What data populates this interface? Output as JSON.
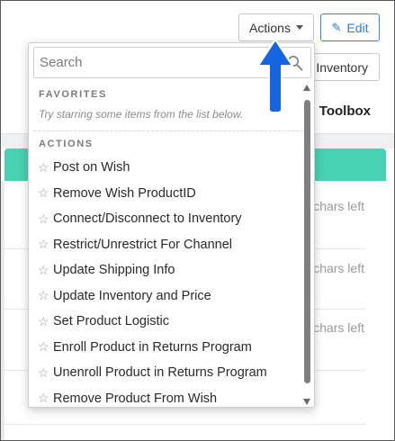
{
  "header": {
    "actions_label": "Actions",
    "edit_label": "Edit",
    "inventory_label": "Inventory",
    "toolbox_label": "Toolbox"
  },
  "background": {
    "chars_left_label": "chars left"
  },
  "dropdown": {
    "search_placeholder": "Search",
    "favorites_title": "FAVORITES",
    "favorites_hint": "Try starring some items from the list below.",
    "actions_title": "ACTIONS",
    "items": [
      {
        "label": "Post on Wish"
      },
      {
        "label": "Remove Wish ProductID"
      },
      {
        "label": "Connect/Disconnect to Inventory"
      },
      {
        "label": "Restrict/Unrestrict For Channel"
      },
      {
        "label": "Update Shipping Info"
      },
      {
        "label": "Update Inventory and Price"
      },
      {
        "label": "Set Product Logistic"
      },
      {
        "label": "Enroll Product in Returns Program"
      },
      {
        "label": "Unenroll Product in Returns Program"
      },
      {
        "label": "Remove Product From Wish"
      }
    ]
  },
  "icons": {
    "star": "star-outline-icon",
    "search": "search-icon",
    "edit": "pencil-icon",
    "caret": "caret-down-icon"
  },
  "colors": {
    "accent_blue": "#2c7be5",
    "teal": "#48d1b2",
    "annotation_arrow": "#1565e0"
  }
}
